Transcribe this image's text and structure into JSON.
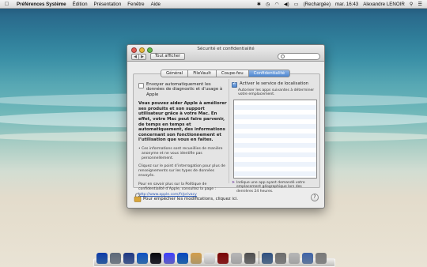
{
  "menubar": {
    "app_name": "Préférences Système",
    "items": [
      "Édition",
      "Présentation",
      "Fenêtre",
      "Aide"
    ],
    "battery": "(Rechargée)",
    "clock": "mar. 16:43",
    "user": "Alexandre LENOIR"
  },
  "window": {
    "title": "Sécurité et confidentialité",
    "show_all": "Tout afficher",
    "tabs": [
      "Général",
      "FileVault",
      "Coupe-feu",
      "Confidentialité"
    ],
    "active_tab": 3
  },
  "left": {
    "diag_checkbox": "Envoyer automatiquement les données de diagnostic et d’usage à Apple",
    "intro_bold": "Vous pouvez aider Apple à améliorer ses produits et son support utilisateur grâce à votre Mac. En effet, votre Mac peut faire parvenir, de temps en temps et automatiquement, des informations concernant son fonctionnement et l’utilisation que vous en faites.",
    "bullet": "Ces informations sont recueillies de manière anonyme et ne vous identifie pas personnellement.",
    "help_text": "Cliquez sur le point d’interrogation pour plus de renseignements sur les types de données envoyés.",
    "policy_text": "Pour en savoir plus sur la Politique de confidentialité d’Apple, consultez la page :",
    "policy_link": "http://www.apple.com/fr/privacy"
  },
  "right": {
    "location_checkbox": "Activer le service de localisation",
    "location_sub": "Autoriser les apps suivantes à déterminer votre emplacement.",
    "note": "Indique une app ayant demandé votre emplacement géographique lors des dernières 24 heures."
  },
  "footer": {
    "lock_text": "Pour empêcher les modifications, cliquez ici.",
    "help": "?"
  },
  "dock": {
    "icons": [
      "finder-icon",
      "launchpad-icon",
      "mission-control-icon",
      "safari-icon",
      "dashboard-icon",
      "itunes-icon",
      "app-store-icon",
      "notes-icon",
      "calendar-icon",
      "photo-booth-icon",
      "tv-icon",
      "system-preferences-icon",
      "applications-folder-icon",
      "documents-folder-icon",
      "preview-icon",
      "downloads-stack-icon",
      "trash-icon"
    ],
    "colors": [
      "#3c7bd0",
      "#9aa4b0",
      "#5a78b8",
      "#3f8fdf",
      "#2d2d3a",
      "#7f7fff",
      "#2e86de",
      "#e8c98b",
      "#f4f4f4",
      "#b02828",
      "#d8d8d8",
      "#8e8e8e",
      "#6e8fb5",
      "#a7a7a7",
      "#d8d8d8",
      "#7f9fcf",
      "#b0b0b0"
    ]
  }
}
